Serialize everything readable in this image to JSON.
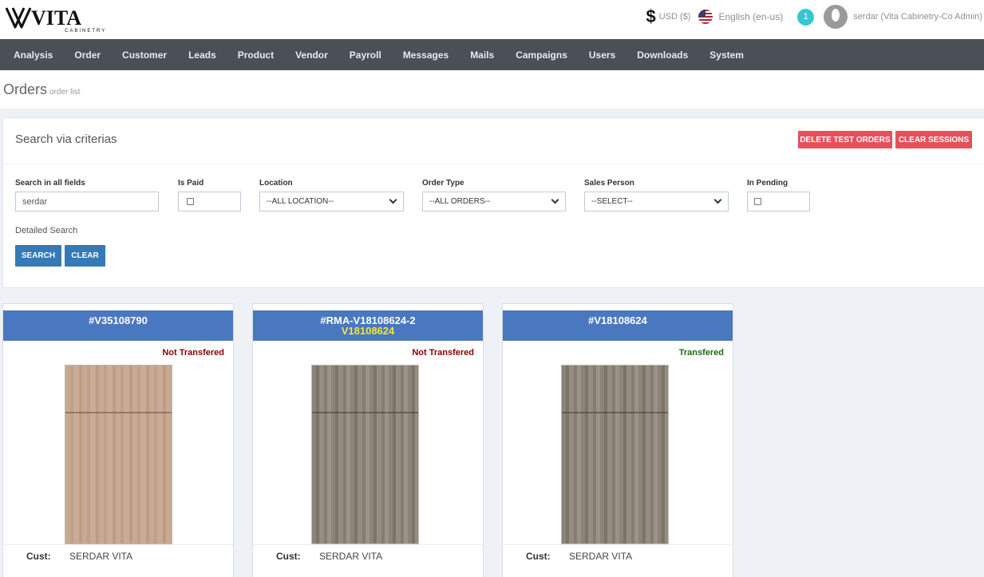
{
  "brand": {
    "name": "VITA",
    "tagline": "CABINETRY"
  },
  "topbar": {
    "currency": "USD ($)",
    "language": "English (en-us)",
    "notification_count": "1",
    "user": "serdar (Vita Cabinetry-Co Admin)",
    "icons": [
      "dollar-icon",
      "us-flag-icon",
      "avatar-icon"
    ]
  },
  "nav": {
    "items": [
      "Analysis",
      "Order",
      "Customer",
      "Leads",
      "Product",
      "Vendor",
      "Payroll",
      "Messages",
      "Mails",
      "Campaigns",
      "Users",
      "Downloads",
      "System"
    ]
  },
  "page": {
    "title": "Orders",
    "subtitle": "order list"
  },
  "search": {
    "title": "Search via criterias",
    "delete_test_orders": "DELETE TEST ORDERS",
    "clear_sessions": "CLEAR SESSIONS",
    "all_fields_label": "Search in all fields",
    "all_fields_value": "serdar",
    "is_paid_label": "Is Paid",
    "location_label": "Location",
    "location_value": "--ALL LOCATION--",
    "order_type_label": "Order Type",
    "order_type_value": "--ALL ORDERS--",
    "sales_person_label": "Sales Person",
    "sales_person_value": "--SELECT--",
    "in_pending_label": "In Pending",
    "detailed_search": "Detailed Search",
    "search_button": "SEARCH",
    "clear_button": "CLEAR"
  },
  "orders": [
    {
      "id": "#V35108790",
      "ref": "",
      "status": "Not Transfered",
      "cust_label": "Cust:",
      "customer": "SERDAR VITA"
    },
    {
      "id": "#RMA-V18108624-2",
      "ref": "V18108624",
      "status": "Not Transfered",
      "cust_label": "Cust:",
      "customer": "SERDAR VITA"
    },
    {
      "id": "#V18108624",
      "ref": "",
      "status": "Transfered",
      "cust_label": "Cust:",
      "customer": "SERDAR VITA"
    }
  ],
  "colors": {
    "nav_bg": "#4a5056",
    "card_header": "#4a78c0",
    "danger": "#e7505a",
    "primary": "#337ab7",
    "badge": "#36c6d3"
  }
}
